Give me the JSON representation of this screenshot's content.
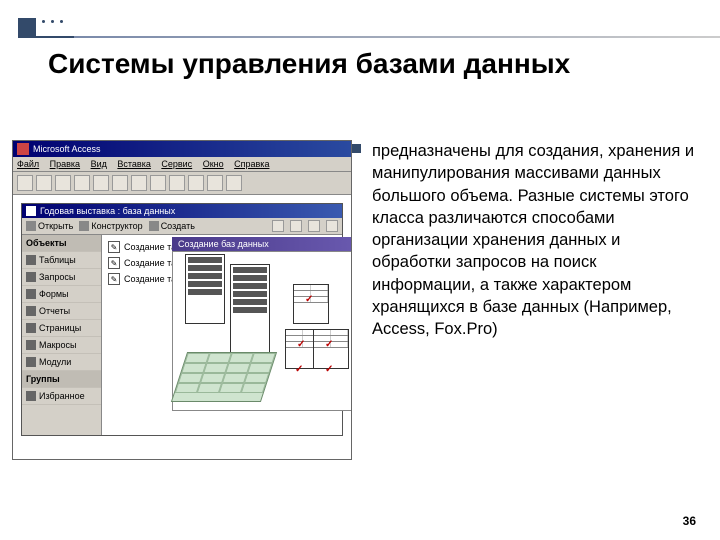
{
  "slide": {
    "title": "Системы управления базами данных",
    "page_number": "36"
  },
  "text": {
    "body": "предназначены для создания, хранения и манипулирования массивами данных большого объема. Разные системы этого класса различаются способами организации хранения данных и обработки запросов на поиск информации, а также характером хранящихся в базе данных (Например, Access, Fox.Pro)"
  },
  "app": {
    "title": "Microsoft Access",
    "menu": [
      "Файл",
      "Правка",
      "Вид",
      "Вставка",
      "Сервис",
      "Окно",
      "Справка"
    ],
    "db_window_title": "Годовая выставка : база данных",
    "db_toolbar": {
      "open": "Открыть",
      "design": "Конструктор",
      "create": "Создать"
    },
    "sidebar": {
      "header_objects": "Объекты",
      "items": [
        "Таблицы",
        "Запросы",
        "Формы",
        "Отчеты",
        "Страницы",
        "Макросы",
        "Модули"
      ],
      "header_groups": "Группы",
      "group_item": "Избранное"
    },
    "main_items": [
      "Создание та…",
      "Создание та…",
      "Создание та…"
    ],
    "overlay_title": "Создание баз данных"
  }
}
